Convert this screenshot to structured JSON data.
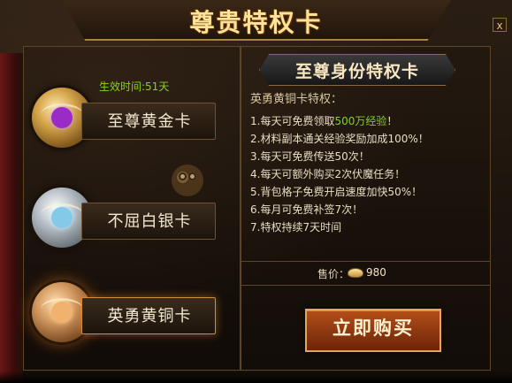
{
  "window": {
    "title": "尊贵特权卡",
    "close_label": "x"
  },
  "cards": [
    {
      "name": "至尊黄金卡",
      "effect": "生效时间:51天",
      "badge_icon": "gold-rank-badge-icon"
    },
    {
      "name": "不屈白银卡",
      "effect": "",
      "badge_icon": "silver-rank-badge-icon"
    },
    {
      "name": "英勇黄铜卡",
      "effect": "",
      "badge_icon": "bronze-rank-badge-icon",
      "selected": true
    }
  ],
  "details": {
    "title": "至尊身份特权卡",
    "privilege_label": "英勇黄铜卡特权：",
    "benefits": [
      {
        "prefix": "1.每天可免费领取",
        "highlight": "500万经验",
        "suffix": "！"
      },
      {
        "prefix": "2.材料副本通关经验奖励加成100%！",
        "highlight": "",
        "suffix": ""
      },
      {
        "prefix": "3.每天可免费传送50次！",
        "highlight": "",
        "suffix": ""
      },
      {
        "prefix": "4.每天可额外购买2次伏魔任务！",
        "highlight": "",
        "suffix": ""
      },
      {
        "prefix": "5.背包格子免费开启速度加快50%！",
        "highlight": "",
        "suffix": ""
      },
      {
        "prefix": "6.每月可免费补签7次！",
        "highlight": "",
        "suffix": ""
      },
      {
        "prefix": "7.特权持续7天时间",
        "highlight": "",
        "suffix": ""
      }
    ],
    "price_label": "售价：",
    "price_value": "980",
    "buy_label": "立即购买"
  },
  "colors": {
    "highlight_green": "#7ed321",
    "active_card_glow": "#ff9d37"
  }
}
